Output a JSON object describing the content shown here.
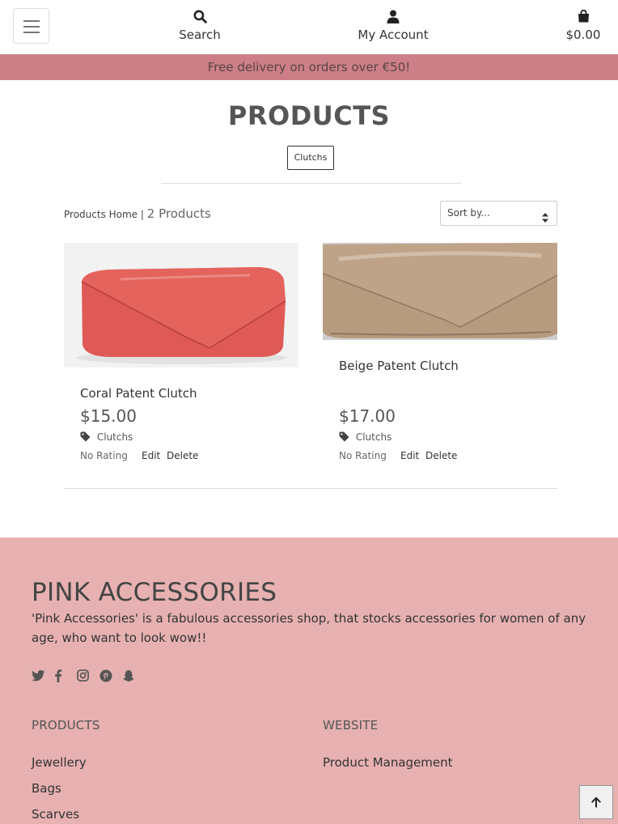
{
  "nav": {
    "search_label": "Search",
    "account_label": "My Account",
    "cart_total": "$0.00"
  },
  "banner": {
    "text": "Free delivery on orders over €50!"
  },
  "page": {
    "title": "PRODUCTS",
    "category_badge": "Clutchs",
    "breadcrumb_link": "Products Home",
    "separator": "|",
    "product_count": "2 Products",
    "sort_placeholder": "Sort by..."
  },
  "products": [
    {
      "name": "Coral Patent Clutch",
      "price": "$15.00",
      "category": "Clutchs",
      "rating": "No Rating",
      "edit_label": "Edit",
      "delete_label": "Delete",
      "image_color": "#e05a55"
    },
    {
      "name": "Beige Patent Clutch",
      "price": "$17.00",
      "category": "Clutchs",
      "rating": "No Rating",
      "edit_label": "Edit",
      "delete_label": "Delete",
      "image_color": "#b99a7d"
    }
  ],
  "footer": {
    "brand": "PINK ACCESSORIES",
    "description": "'Pink Accessories' is a fabulous accessories shop, that stocks accessories for women of any age, who want to look wow!!",
    "social_icons": [
      "twitter-icon",
      "facebook-icon",
      "instagram-icon",
      "pinterest-icon",
      "snapchat-icon"
    ],
    "products_heading": "PRODUCTS",
    "products_links": [
      "Jewellery",
      "Bags",
      "Scarves"
    ],
    "website_heading": "WEBSITE",
    "website_links": [
      "Product Management"
    ]
  },
  "colors": {
    "banner_bg": "#cc7f86",
    "footer_bg": "#e7b1b1"
  }
}
